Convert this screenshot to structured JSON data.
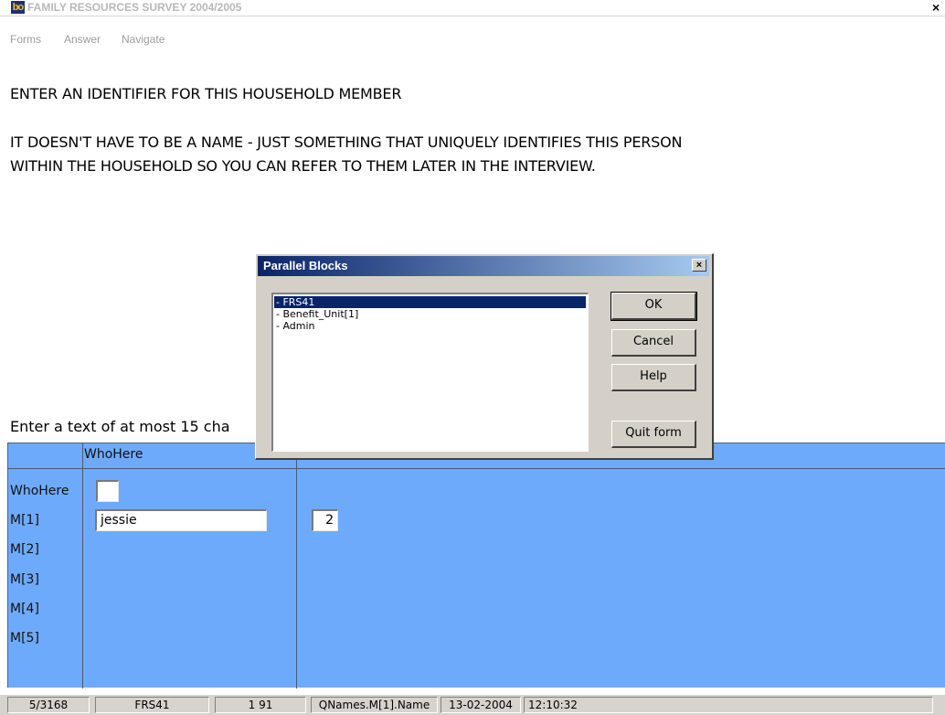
{
  "window": {
    "icon_text": "bo",
    "title": "FAMILY RESOURCES SURVEY 2004/2005",
    "close_glyph": "×"
  },
  "menu": {
    "items": [
      "Forms",
      "Answer",
      "Navigate"
    ]
  },
  "question": {
    "line1": "ENTER AN IDENTIFIER FOR THIS HOUSEHOLD MEMBER",
    "line2": "IT DOESN'T HAVE TO BE A NAME - JUST SOMETHING THAT UNIQUELY IDENTIFIES THIS PERSON",
    "line3": "WITHIN THE HOUSEHOLD SO YOU CAN REFER TO THEM LATER IN THE INTERVIEW."
  },
  "instruction": "Enter a text of at most 15 cha",
  "grid": {
    "column_header": "WhoHere",
    "rows": [
      "WhoHere",
      "M[1]",
      "M[2]",
      "M[3]",
      "M[4]",
      "M[5]"
    ],
    "m1_name_value": "jessie",
    "m1_number_value": "2",
    "whohere_value": ""
  },
  "dialog": {
    "title": "Parallel Blocks",
    "close_glyph": "×",
    "items": [
      "- FRS41",
      "- Benefit_Unit[1]",
      "- Admin"
    ],
    "selected_index": 0,
    "buttons": {
      "ok": "OK",
      "cancel": "Cancel",
      "help": "Help",
      "quit": "Quit form"
    }
  },
  "status": {
    "position": "5/3168",
    "block": "FRS41",
    "counts": "1   91",
    "field": "QNames.M[1].Name",
    "date": "13-02-2004",
    "time": "12:10:32"
  }
}
